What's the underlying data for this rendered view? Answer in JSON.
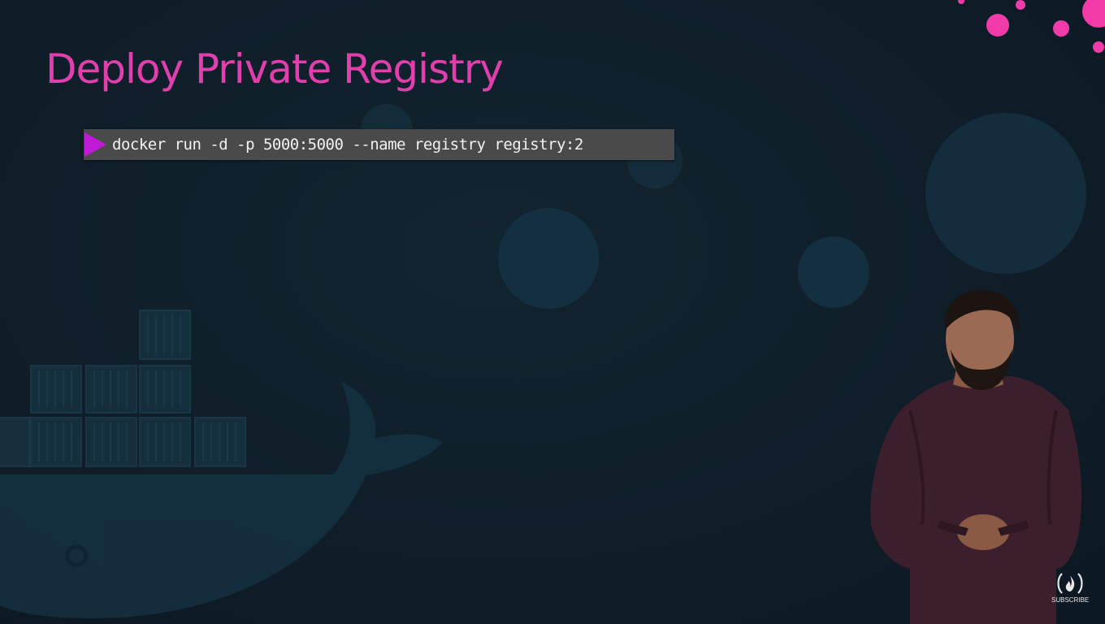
{
  "slide": {
    "title": "Deploy Private Registry",
    "command": "docker run -d -p 5000:5000 --name registry registry:2"
  },
  "overlay": {
    "subscribe_label": "SUBSCRIBE"
  },
  "icons": {
    "play": "play-triangle-icon",
    "subscribe": "freecodecamp-flame-icon",
    "docker": "docker-whale-icon"
  },
  "colors": {
    "background": "#0f1d28",
    "title": "#e13fae",
    "command_box": "#4a4a4a",
    "command_text": "#f2f2f2",
    "play_icon": "#c21bd8",
    "decor_dots": "#f03ba8"
  }
}
